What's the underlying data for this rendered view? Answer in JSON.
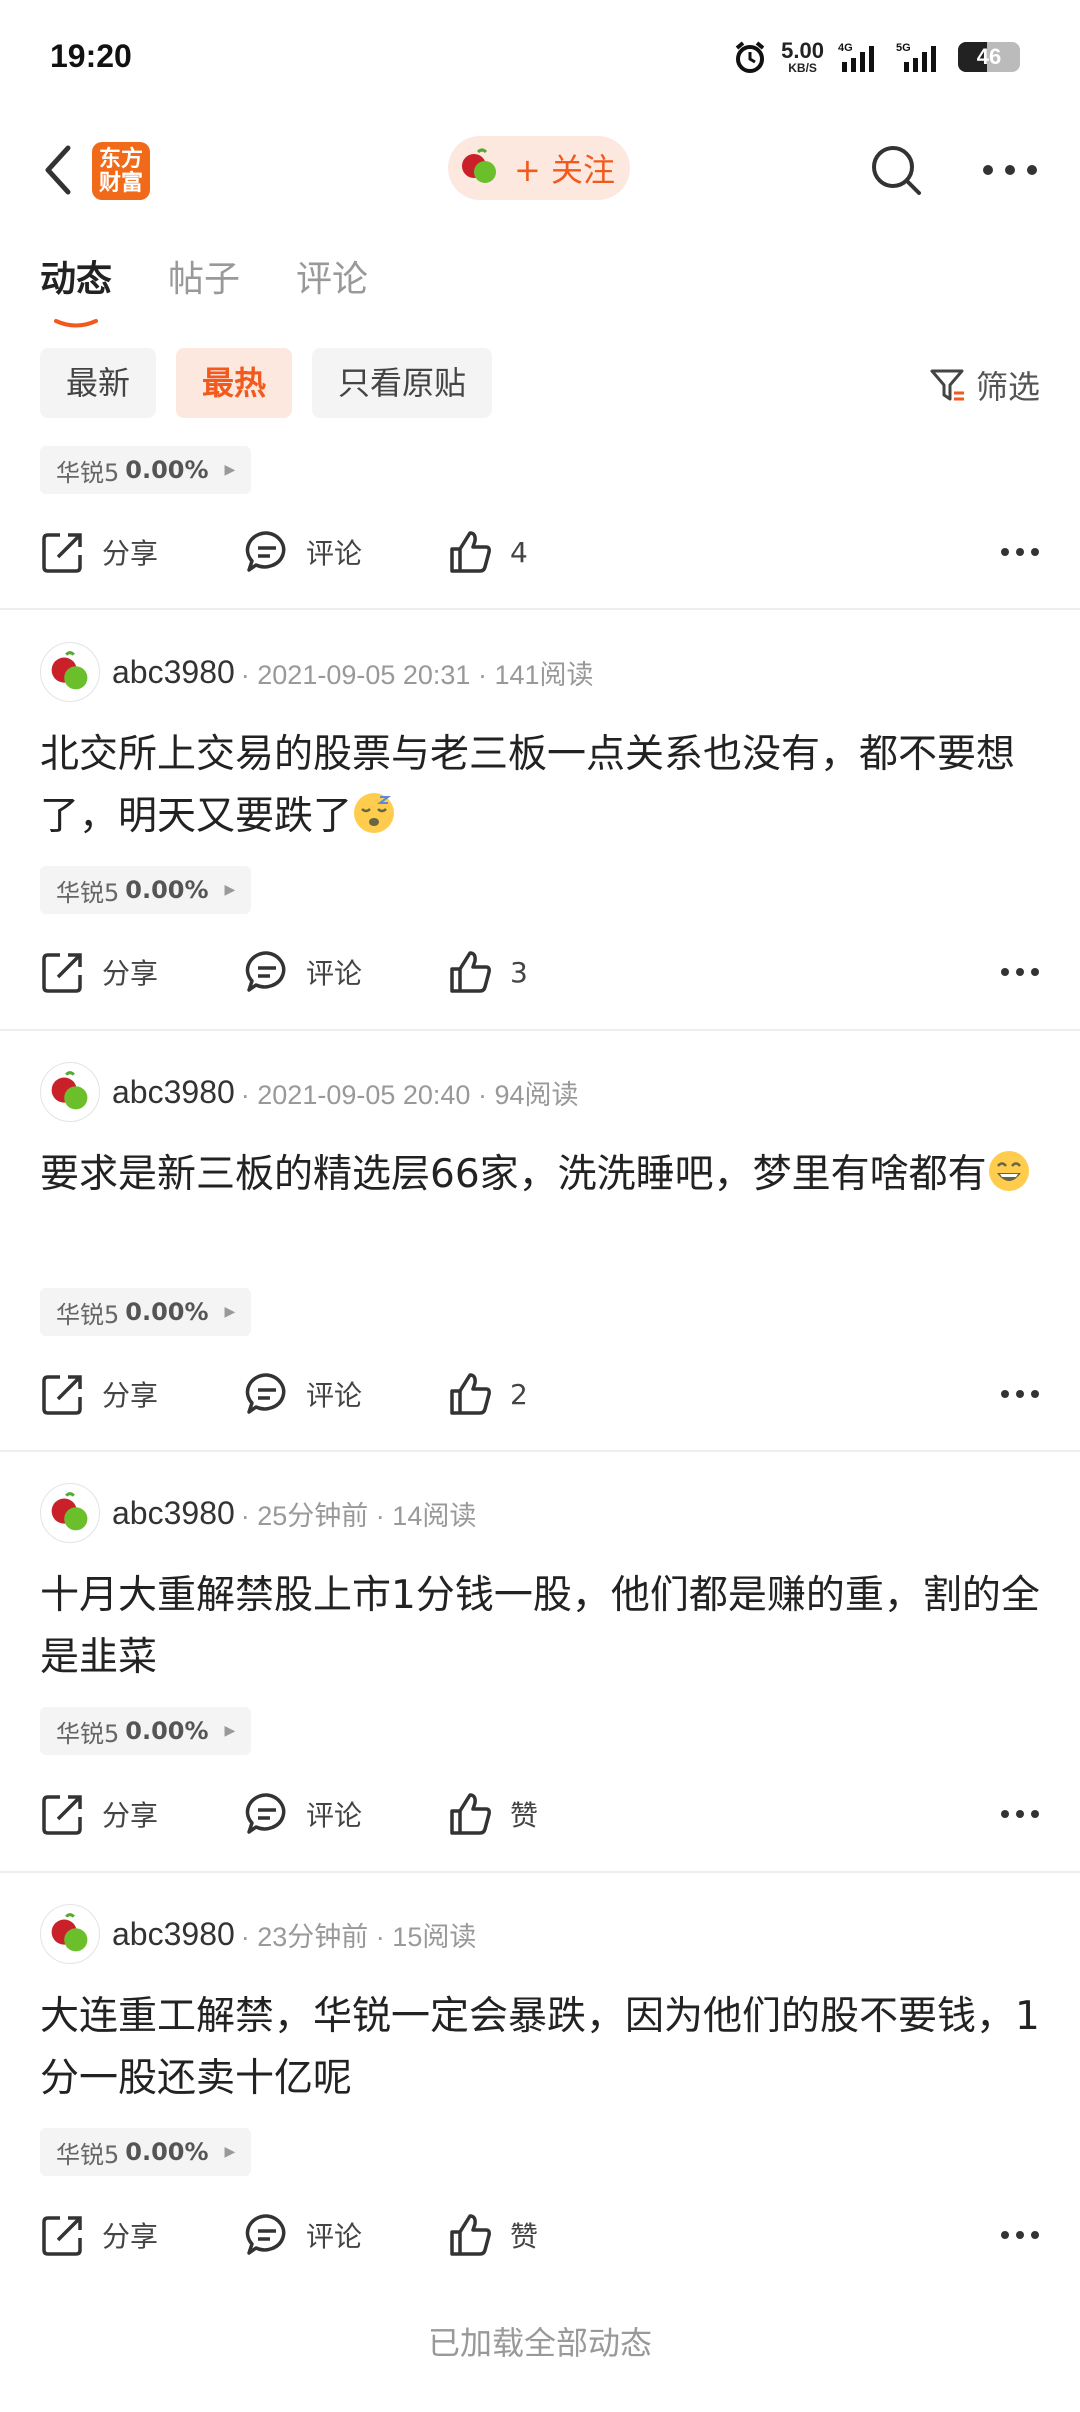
{
  "status_bar": {
    "time": "19:20",
    "speed_value": "5.00",
    "speed_unit": "KB/S",
    "net1": "4G",
    "net2": "5G",
    "battery": "46",
    "battery_level": 0.46
  },
  "header": {
    "logo_text_1": "东方",
    "logo_text_2": "财富",
    "follow_label": "+ 关注"
  },
  "tabs": [
    {
      "label": "动态",
      "active": true
    },
    {
      "label": "帖子",
      "active": false
    },
    {
      "label": "评论",
      "active": false
    }
  ],
  "filters": [
    {
      "label": "最新",
      "active": false
    },
    {
      "label": "最热",
      "active": true
    },
    {
      "label": "只看原贴",
      "active": false
    }
  ],
  "filter_button": "筛选",
  "action_labels": {
    "share": "分享",
    "comment": "评论"
  },
  "stock_tag": {
    "name": "华锐5",
    "change": "0.00%"
  },
  "top_partial": {
    "likes": "4"
  },
  "posts": [
    {
      "user": "abc3980",
      "meta": "· 2021-09-05 20:31 · 141阅读",
      "content": "北交所上交易的股票与老三板一点关系也没有，都不要想了，明天又要跌了",
      "emoji": "sleepy-face-emoji",
      "likes": "3"
    },
    {
      "user": "abc3980",
      "meta": "· 2021-09-05 20:40 · 94阅读",
      "content": "要求是新三板的精选层66家，洗洗睡吧，梦里有啥都有",
      "emoji": "grinning-face-emoji",
      "likes": "2"
    },
    {
      "user": "abc3980",
      "meta": "· 25分钟前 · 14阅读",
      "content": "十月大重解禁股上市1分钱一股，他们都是赚的重，割的全是韭菜",
      "emoji": "",
      "likes": "赞"
    },
    {
      "user": "abc3980",
      "meta": "· 23分钟前 · 15阅读",
      "content": "大连重工解禁，华锐一定会暴跌，因为他们的股不要钱，1分一股还卖十亿呢",
      "emoji": "",
      "likes": "赞"
    }
  ],
  "footer_text": "已加载全部动态",
  "colors": {
    "accent": "#f25a1d",
    "logo_bg": "#f06a1a",
    "chip_active_bg": "#fde8e0"
  }
}
